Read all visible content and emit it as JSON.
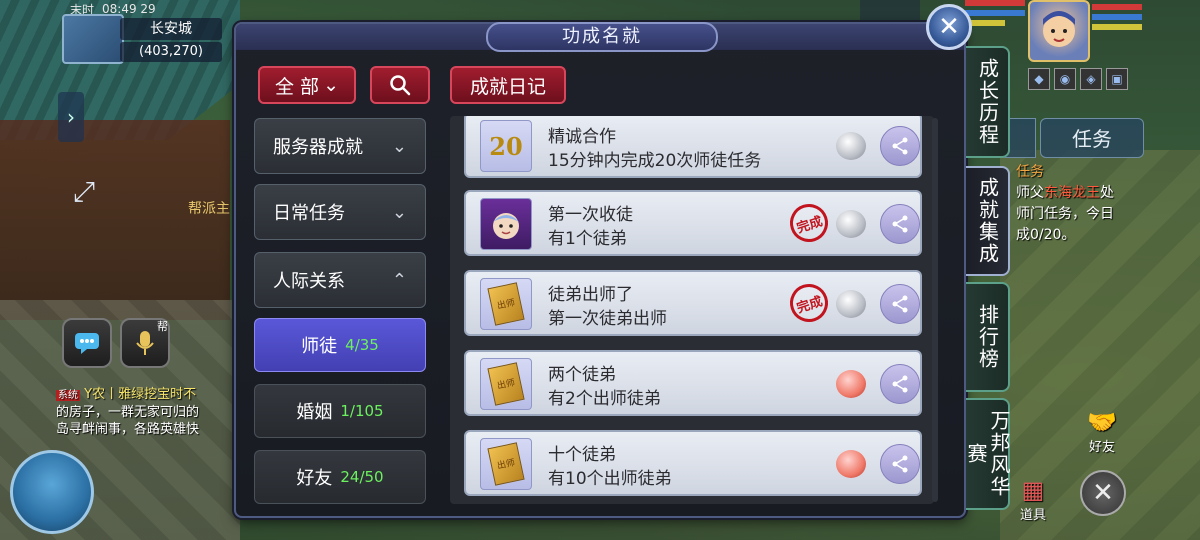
{
  "hud": {
    "time_label": "末时",
    "clock": "08:49 29",
    "city": "长安城",
    "coords": "(403,270)",
    "gang_label": "帮派主",
    "voice_tag": "帮",
    "side_arrow": "›",
    "expand_icon": "⤢"
  },
  "chat": {
    "sys_tag": "系统",
    "line1": "Y农丨雅绿挖宝时不",
    "line2": "的房子，一群无家可归的",
    "line3": "岛寻衅闹事，各路英雄快"
  },
  "right_hud": {
    "task_tab": "任务",
    "task_title": "任务",
    "task_line1_a": "师父",
    "task_line1_b": "东海龙王",
    "task_line1_c": "处",
    "task_line2": "师门任务，今日",
    "task_line3": "成0/20。",
    "friend_label": "好友",
    "item_label": "道具"
  },
  "panel": {
    "title": "功成名就",
    "close_icon": "✕",
    "all_label": "全 部",
    "all_chevron": "⌄",
    "search_icon": "⚲",
    "diary_label": "成就日记"
  },
  "categories": [
    {
      "label": "服务器成就",
      "chevron": "⌄"
    },
    {
      "label": "日常任务",
      "chevron": "⌄"
    },
    {
      "label": "人际关系",
      "chevron": "⌃"
    }
  ],
  "subcategories": [
    {
      "label": "师徒",
      "count": "4/35",
      "active": true
    },
    {
      "label": "婚姻",
      "count": "1/105",
      "active": false
    },
    {
      "label": "好友",
      "count": "24/50",
      "active": false
    }
  ],
  "achievements": [
    {
      "icon": "20",
      "title": "精诚合作",
      "desc": "15分钟内完成20次师徒任务",
      "completed": false,
      "reward": "silver"
    },
    {
      "icon": "face",
      "title": "第一次收徒",
      "desc": "有1个徒弟",
      "completed": true,
      "reward": "silver"
    },
    {
      "icon": "doc",
      "title": "徒弟出师了",
      "desc": "第一次徒弟出师",
      "completed": true,
      "reward": "silver"
    },
    {
      "icon": "doc",
      "title": "两个徒弟",
      "desc": "有2个出师徒弟",
      "completed": false,
      "reward": "peach"
    },
    {
      "icon": "doc",
      "title": "十个徒弟",
      "desc": "有10个出师徒弟",
      "completed": false,
      "reward": "peach"
    }
  ],
  "stamp_text": "完成",
  "doc_icon_text": "出师",
  "share_icon": "≺",
  "vertical_tabs": [
    {
      "label": "成长历程",
      "active": false
    },
    {
      "label": "成就集成",
      "active": true
    },
    {
      "label": "排行榜",
      "active": false
    },
    {
      "label": "万邦风华赛",
      "active": false
    }
  ]
}
